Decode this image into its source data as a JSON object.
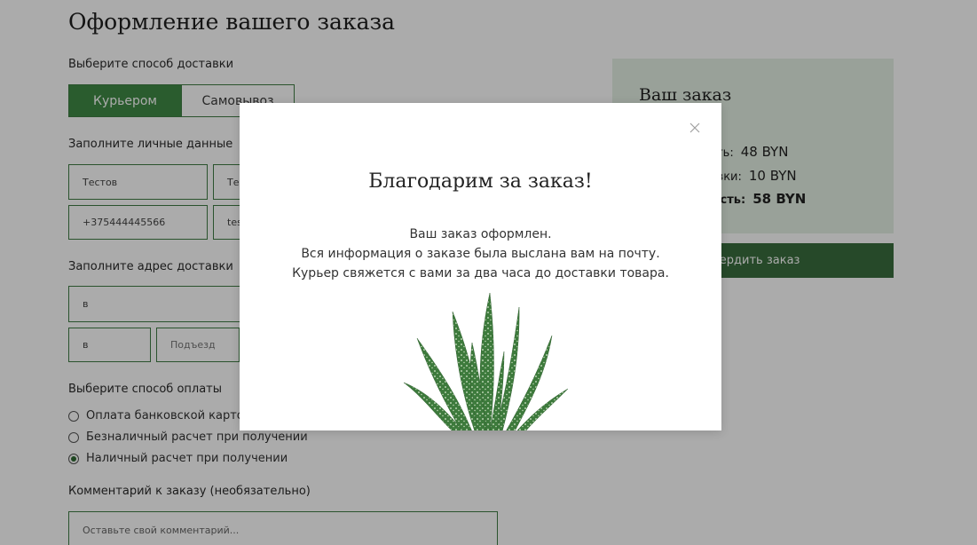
{
  "page": {
    "title": "Оформление вашего заказа"
  },
  "delivery": {
    "label": "Выберите способ доставки",
    "options": [
      "Курьером",
      "Самовывоз"
    ],
    "selected": "Курьером"
  },
  "personal": {
    "label": "Заполните личные данные",
    "name_value": "Тестов",
    "surname_value": "Тес",
    "phone_value": "+375444445566",
    "email_value": "tes"
  },
  "address": {
    "label": "Заполните адрес доставки",
    "street_value": "в",
    "house_value": "в",
    "entrance_placeholder": "Подъезд"
  },
  "payment": {
    "label": "Выберите способ оплаты",
    "options": [
      "Оплата банковской картой",
      "Безналичный расчет при получении",
      "Наличный расчет при получении"
    ],
    "selected_index": 2
  },
  "comment": {
    "label": "Комментарий к заказу (необязательно)",
    "placeholder": "Оставьте свой комментарий..."
  },
  "summary": {
    "title": "Ваш заказ",
    "cost_label": "ость:",
    "cost_value": "48 BYN",
    "delivery_label": "тавки:",
    "delivery_value": "10 BYN",
    "total_label": "мость:",
    "total_value": "58 BYN",
    "confirm_label": "твердить заказ"
  },
  "modal": {
    "title": "Благодарим за заказ!",
    "lines": [
      "Ваш заказ оформлен.",
      "Вся информация о заказе была выслана вам на почту.",
      "Курьер свяжется с вами за два часа до доставки товара."
    ],
    "close_icon": "close-icon",
    "image": "aloe-plant-illustration"
  },
  "colors": {
    "accent": "#3f8a45",
    "button_dark": "#3a6e3e",
    "summary_bg": "#e5f1e4"
  }
}
